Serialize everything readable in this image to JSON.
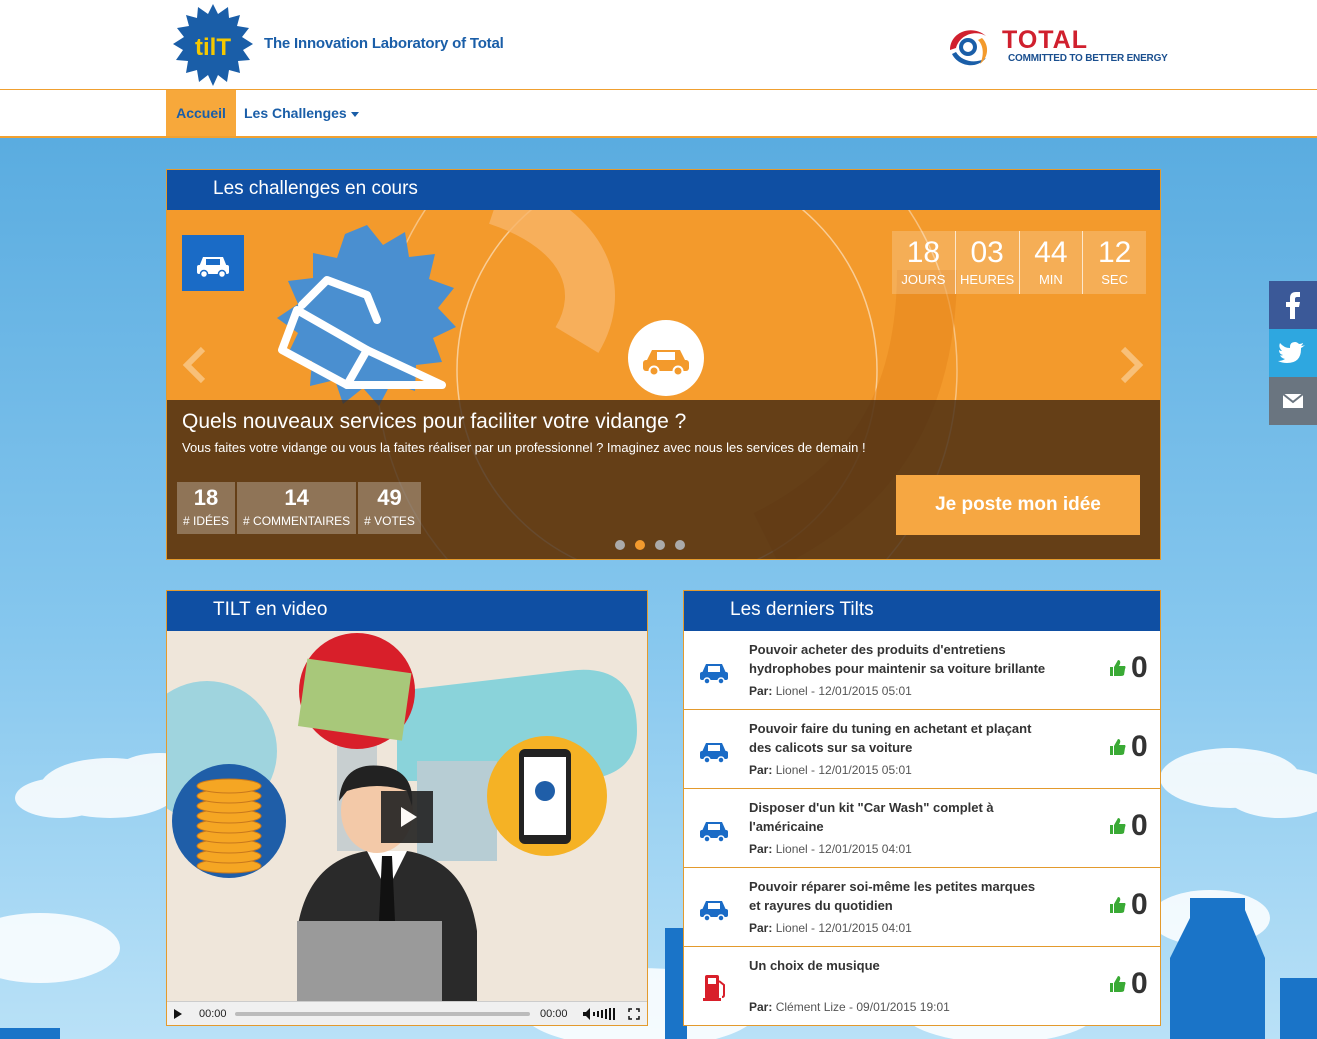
{
  "header": {
    "logo_text": "tilT",
    "tagline": "The Innovation Laboratory of Total",
    "brand": "TOTAL",
    "brand_sub": "COMMITTED TO BETTER ENERGY"
  },
  "nav": {
    "home": "Accueil",
    "challenges": "Les Challenges"
  },
  "challenges": {
    "panel_title": "Les challenges en cours",
    "countdown": [
      {
        "value": "18",
        "label": "JOURS"
      },
      {
        "value": "03",
        "label": "HEURES"
      },
      {
        "value": "44",
        "label": "MIN"
      },
      {
        "value": "12",
        "label": "SEC"
      }
    ],
    "title": "Quels nouveaux services pour faciliter votre vidange ?",
    "description": "Vous faites votre vidange ou vous la faites réaliser par un professionnel ? Imaginez avec nous les services de demain !",
    "stats": [
      {
        "value": "18",
        "label": "# IDÉES"
      },
      {
        "value": "14",
        "label": "# COMMENTAIRES"
      },
      {
        "value": "49",
        "label": "# VOTES"
      }
    ],
    "cta": "Je poste mon idée",
    "slides_count": 4,
    "active_slide": 2
  },
  "video": {
    "panel_title": "TILT en video",
    "time_current": "00:00",
    "time_total": "00:00"
  },
  "tilts": {
    "panel_title": "Les derniers Tilts",
    "meta_prefix": "Par:",
    "items": [
      {
        "icon": "car-icon",
        "text": "Pouvoir acheter des produits d'entretiens hydrophobes pour maintenir sa voiture brillante",
        "author": "Lionel - 12/01/2015 05:01",
        "score": "0"
      },
      {
        "icon": "car-icon",
        "text": "Pouvoir faire du tuning en achetant et plaçant des calicots sur sa voiture",
        "author": "Lionel - 12/01/2015 05:01",
        "score": "0"
      },
      {
        "icon": "car-icon",
        "text": "Disposer d'un kit \"Car Wash\" complet à l'américaine",
        "author": "Lionel - 12/01/2015 04:01",
        "score": "0"
      },
      {
        "icon": "car-icon",
        "text": "Pouvoir réparer soi-même les petites marques et rayures du quotidien",
        "author": "Lionel - 12/01/2015 04:01",
        "score": "0"
      },
      {
        "icon": "fuel-pump-icon",
        "text": "Un choix de musique",
        "author": "Clément Lize - 09/01/2015 19:01",
        "score": "0"
      }
    ]
  },
  "colors": {
    "primary_blue": "#0f4fa3",
    "accent_orange": "#f29a2e",
    "vote_green": "#3aaa35",
    "brand_red": "#d0202e"
  }
}
